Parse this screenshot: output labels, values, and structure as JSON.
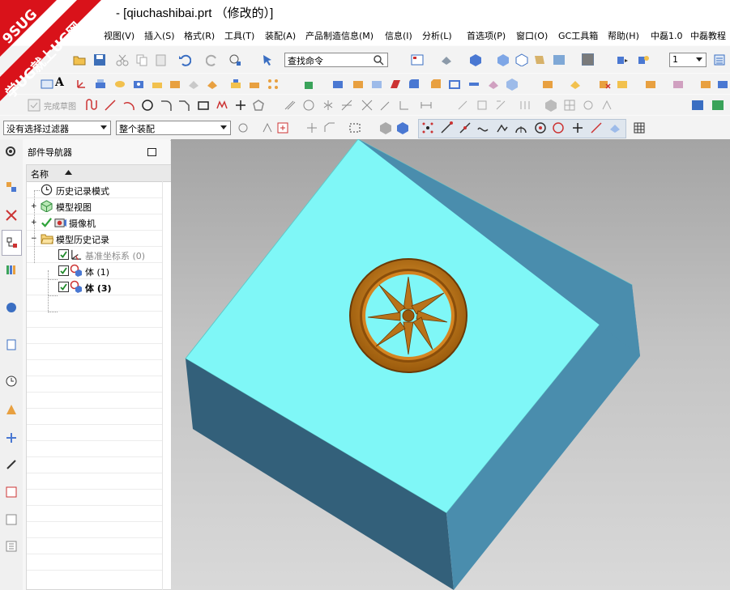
{
  "window": {
    "title": "- [qiuchashibai.prt （修改的）]"
  },
  "watermark": {
    "line1": "9SUG",
    "line2": "学UG就上UG网"
  },
  "menu": [
    "视图(V)",
    "插入(S)",
    "格式(R)",
    "工具(T)",
    "装配(A)",
    "产品制造信息(M)",
    "信息(I)",
    "分析(L)",
    "首选项(P)",
    "窗口(O)",
    "GC工具箱",
    "帮助(H)",
    "中磊1.0",
    "中磊教程"
  ],
  "toolbar": {
    "search_placeholder": "查找命令",
    "layer_value": "1",
    "finish_sketch": "完成草图",
    "filter_value": "没有选择过滤器",
    "assembly_value": "整个装配"
  },
  "navigator": {
    "title": "部件导航器",
    "column_name": "名称",
    "items": [
      {
        "label": "历史记录模式"
      },
      {
        "label": "模型视图"
      },
      {
        "label": "摄像机"
      },
      {
        "label": "模型历史记录"
      },
      {
        "label": "基准坐标系 (0)"
      },
      {
        "label": "体 (1)"
      },
      {
        "label": "体 (3)"
      }
    ]
  },
  "colors": {
    "block_top": "#7ff7f7",
    "block_side_left": "#33607a",
    "block_side_right": "#4a8dad",
    "emblem": "#c8821a"
  }
}
